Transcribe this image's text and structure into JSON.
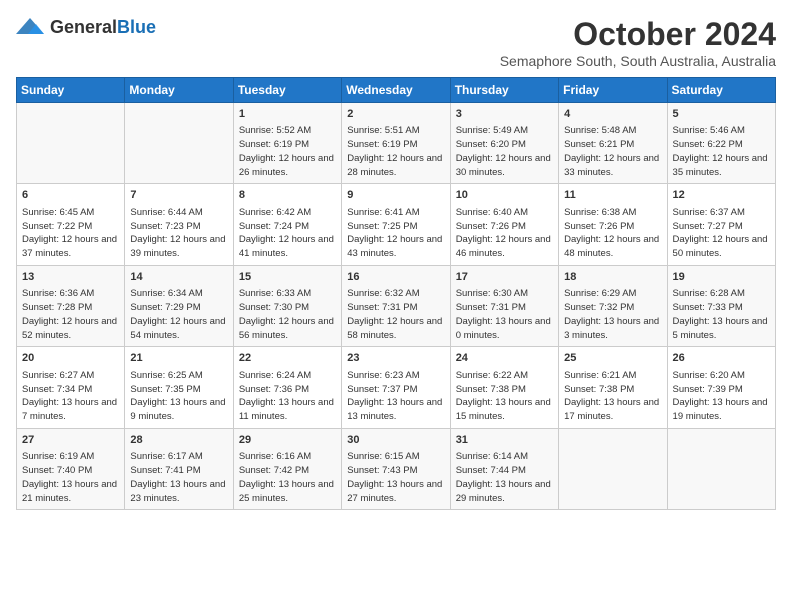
{
  "logo": {
    "text_general": "General",
    "text_blue": "Blue"
  },
  "title": "October 2024",
  "subtitle": "Semaphore South, South Australia, Australia",
  "days_of_week": [
    "Sunday",
    "Monday",
    "Tuesday",
    "Wednesday",
    "Thursday",
    "Friday",
    "Saturday"
  ],
  "weeks": [
    [
      {
        "day": "",
        "info": ""
      },
      {
        "day": "",
        "info": ""
      },
      {
        "day": "1",
        "info": "Sunrise: 5:52 AM\nSunset: 6:19 PM\nDaylight: 12 hours and 26 minutes."
      },
      {
        "day": "2",
        "info": "Sunrise: 5:51 AM\nSunset: 6:19 PM\nDaylight: 12 hours and 28 minutes."
      },
      {
        "day": "3",
        "info": "Sunrise: 5:49 AM\nSunset: 6:20 PM\nDaylight: 12 hours and 30 minutes."
      },
      {
        "day": "4",
        "info": "Sunrise: 5:48 AM\nSunset: 6:21 PM\nDaylight: 12 hours and 33 minutes."
      },
      {
        "day": "5",
        "info": "Sunrise: 5:46 AM\nSunset: 6:22 PM\nDaylight: 12 hours and 35 minutes."
      }
    ],
    [
      {
        "day": "6",
        "info": "Sunrise: 6:45 AM\nSunset: 7:22 PM\nDaylight: 12 hours and 37 minutes."
      },
      {
        "day": "7",
        "info": "Sunrise: 6:44 AM\nSunset: 7:23 PM\nDaylight: 12 hours and 39 minutes."
      },
      {
        "day": "8",
        "info": "Sunrise: 6:42 AM\nSunset: 7:24 PM\nDaylight: 12 hours and 41 minutes."
      },
      {
        "day": "9",
        "info": "Sunrise: 6:41 AM\nSunset: 7:25 PM\nDaylight: 12 hours and 43 minutes."
      },
      {
        "day": "10",
        "info": "Sunrise: 6:40 AM\nSunset: 7:26 PM\nDaylight: 12 hours and 46 minutes."
      },
      {
        "day": "11",
        "info": "Sunrise: 6:38 AM\nSunset: 7:26 PM\nDaylight: 12 hours and 48 minutes."
      },
      {
        "day": "12",
        "info": "Sunrise: 6:37 AM\nSunset: 7:27 PM\nDaylight: 12 hours and 50 minutes."
      }
    ],
    [
      {
        "day": "13",
        "info": "Sunrise: 6:36 AM\nSunset: 7:28 PM\nDaylight: 12 hours and 52 minutes."
      },
      {
        "day": "14",
        "info": "Sunrise: 6:34 AM\nSunset: 7:29 PM\nDaylight: 12 hours and 54 minutes."
      },
      {
        "day": "15",
        "info": "Sunrise: 6:33 AM\nSunset: 7:30 PM\nDaylight: 12 hours and 56 minutes."
      },
      {
        "day": "16",
        "info": "Sunrise: 6:32 AM\nSunset: 7:31 PM\nDaylight: 12 hours and 58 minutes."
      },
      {
        "day": "17",
        "info": "Sunrise: 6:30 AM\nSunset: 7:31 PM\nDaylight: 13 hours and 0 minutes."
      },
      {
        "day": "18",
        "info": "Sunrise: 6:29 AM\nSunset: 7:32 PM\nDaylight: 13 hours and 3 minutes."
      },
      {
        "day": "19",
        "info": "Sunrise: 6:28 AM\nSunset: 7:33 PM\nDaylight: 13 hours and 5 minutes."
      }
    ],
    [
      {
        "day": "20",
        "info": "Sunrise: 6:27 AM\nSunset: 7:34 PM\nDaylight: 13 hours and 7 minutes."
      },
      {
        "day": "21",
        "info": "Sunrise: 6:25 AM\nSunset: 7:35 PM\nDaylight: 13 hours and 9 minutes."
      },
      {
        "day": "22",
        "info": "Sunrise: 6:24 AM\nSunset: 7:36 PM\nDaylight: 13 hours and 11 minutes."
      },
      {
        "day": "23",
        "info": "Sunrise: 6:23 AM\nSunset: 7:37 PM\nDaylight: 13 hours and 13 minutes."
      },
      {
        "day": "24",
        "info": "Sunrise: 6:22 AM\nSunset: 7:38 PM\nDaylight: 13 hours and 15 minutes."
      },
      {
        "day": "25",
        "info": "Sunrise: 6:21 AM\nSunset: 7:38 PM\nDaylight: 13 hours and 17 minutes."
      },
      {
        "day": "26",
        "info": "Sunrise: 6:20 AM\nSunset: 7:39 PM\nDaylight: 13 hours and 19 minutes."
      }
    ],
    [
      {
        "day": "27",
        "info": "Sunrise: 6:19 AM\nSunset: 7:40 PM\nDaylight: 13 hours and 21 minutes."
      },
      {
        "day": "28",
        "info": "Sunrise: 6:17 AM\nSunset: 7:41 PM\nDaylight: 13 hours and 23 minutes."
      },
      {
        "day": "29",
        "info": "Sunrise: 6:16 AM\nSunset: 7:42 PM\nDaylight: 13 hours and 25 minutes."
      },
      {
        "day": "30",
        "info": "Sunrise: 6:15 AM\nSunset: 7:43 PM\nDaylight: 13 hours and 27 minutes."
      },
      {
        "day": "31",
        "info": "Sunrise: 6:14 AM\nSunset: 7:44 PM\nDaylight: 13 hours and 29 minutes."
      },
      {
        "day": "",
        "info": ""
      },
      {
        "day": "",
        "info": ""
      }
    ]
  ]
}
